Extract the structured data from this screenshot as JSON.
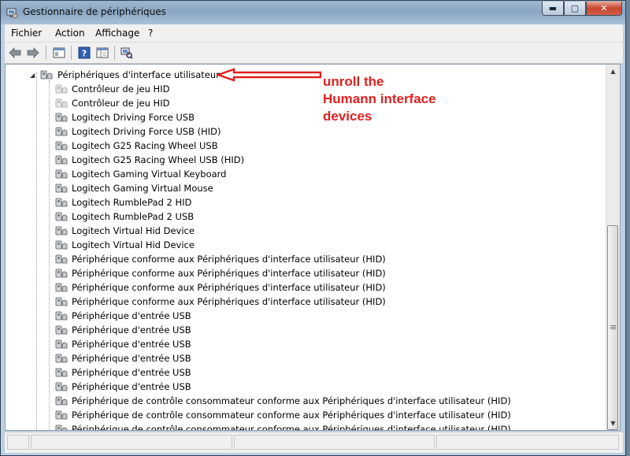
{
  "window": {
    "title": "Gestionnaire de périphériques",
    "controls": {
      "minimize": "▬",
      "maximize": "▢",
      "close": "✕"
    }
  },
  "menu": [
    "Fichier",
    "Action",
    "Affichage",
    "?"
  ],
  "toolbar_icons": [
    "back-arrow-icon",
    "forward-arrow-icon",
    "properties-window-icon",
    "help-icon",
    "console-view-icon",
    "scan-hardware-icon"
  ],
  "tree": {
    "category": "Périphériques d'interface utilisateur",
    "items": [
      "Contrôleur de jeu HID",
      "Contrôleur de jeu HID",
      "Logitech Driving Force USB",
      "Logitech Driving Force USB (HID)",
      "Logitech G25 Racing Wheel USB",
      "Logitech G25 Racing Wheel USB (HID)",
      "Logitech Gaming Virtual Keyboard",
      "Logitech Gaming Virtual Mouse",
      "Logitech RumblePad 2 HID",
      "Logitech RumblePad 2 USB",
      "Logitech Virtual Hid Device",
      "Logitech Virtual Hid Device",
      "Périphérique conforme aux Périphériques d'interface utilisateur (HID)",
      "Périphérique conforme aux Périphériques d'interface utilisateur (HID)",
      "Périphérique conforme aux Périphériques d'interface utilisateur (HID)",
      "Périphérique conforme aux Périphériques d'interface utilisateur (HID)",
      "Périphérique d'entrée USB",
      "Périphérique d'entrée USB",
      "Périphérique d'entrée USB",
      "Périphérique d'entrée USB",
      "Périphérique d'entrée USB",
      "Périphérique d'entrée USB",
      "Périphérique de contrôle consommateur conforme aux Périphériques d'interface utilisateur (HID)",
      "Périphérique de contrôle consommateur conforme aux Périphériques d'interface utilisateur (HID)",
      "Périphérique de contrôle consommateur conforme aux Périphériques d'interface utilisateur (HID)"
    ]
  },
  "annotation": {
    "lines": [
      "unroll the",
      "Humann interface",
      "devices"
    ],
    "color": "#e02020"
  },
  "colors": {
    "titlebar": "#9fb7cf",
    "content_bg": "#ffffff",
    "annotation": "#e02020"
  }
}
